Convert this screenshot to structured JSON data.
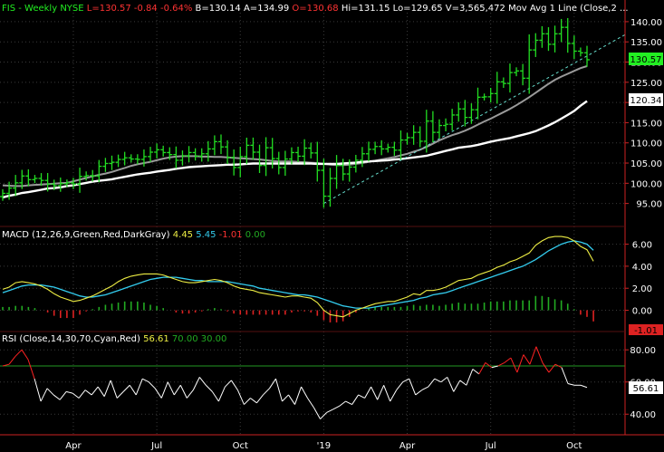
{
  "header": {
    "symbol": "FIS",
    "period": "Weekly",
    "exchange": "NYSE",
    "last": "L=130.57",
    "change": "-0.84",
    "change_pct": "-0.64%",
    "bid": "B=130.14",
    "ask": "A=134.99",
    "open": "O=130.68",
    "high": "Hi=131.15",
    "low": "Lo=129.65",
    "volume": "V=3,565,472",
    "ma_title": "Mov Avg 1 Line (Close,2 ..."
  },
  "macd_header": {
    "name": "MACD (12,26,9,Green,Red,DarkGray)",
    "v1": "4.45",
    "v2": "5.45",
    "v3": "-1.01",
    "v4": "0.00"
  },
  "rsi_header": {
    "name": "RSI (Close,14,30,70,Cyan,Red)",
    "v1": "56.61",
    "v2": "70.00",
    "v3": "30.00"
  },
  "x_labels": [
    "Apr",
    "Jul",
    "Oct",
    "'19",
    "Apr",
    "Jul",
    "Oct"
  ],
  "price_ticks": [
    "140.00",
    "135.00",
    "130.00",
    "125.00",
    "120.00",
    "115.00",
    "110.00",
    "105.00",
    "100.00",
    "95.00"
  ],
  "macd_ticks": [
    "6.00",
    "4.00",
    "2.00",
    "0.00"
  ],
  "rsi_ticks": [
    "80.00",
    "60.00",
    "40.00"
  ],
  "badges": {
    "last_price": "130.57",
    "ma_value": "120.34",
    "macd_hist": "-1.01",
    "rsi_value": "56.61"
  },
  "colors": {
    "bars": "#22dd22",
    "ma_white": "#ffffff",
    "ma_gray": "#9a9a9a",
    "trendline": "#66ddcc",
    "macd": "#eeee44",
    "signal": "#33ccee",
    "hist_pos": "#22aa22",
    "hist_neg": "#dd2222",
    "rsi": "#ffffff",
    "rsi_overbought": "#ff2222",
    "rsi_70": "#229922",
    "badge_last": "#22ee22"
  },
  "chart_data": [
    {
      "type": "ohlc",
      "title": "FIS - Weekly  NYSE",
      "period": "weekly",
      "x_axis_labels": [
        "Apr",
        "Jul",
        "Oct",
        "'19",
        "Apr",
        "Jul",
        "Oct"
      ],
      "ylim": [
        92,
        142
      ],
      "last": 130.57,
      "start_year": 2018,
      "end_year": 2019,
      "close": [
        97.5,
        98.8,
        100.1,
        101.8,
        100.9,
        101.2,
        100.7,
        99.8,
        99.4,
        99.9,
        100.1,
        99.8,
        101.7,
        101.9,
        101.8,
        104.2,
        104.9,
        105.2,
        105.9,
        106.3,
        106.0,
        105.9,
        106.6,
        107.7,
        108.3,
        107.6,
        107.1,
        105.7,
        106.8,
        107.6,
        106.7,
        107.3,
        108.5,
        110.3,
        109.0,
        106.4,
        103.9,
        106.6,
        109.4,
        107.7,
        104.4,
        108.8,
        106.1,
        103.9,
        106.0,
        107.6,
        106.7,
        108.7,
        107.5,
        103.2,
        96.8,
        101.2,
        104.4,
        102.3,
        104.0,
        105.7,
        107.3,
        108.4,
        109.1,
        108.5,
        108.9,
        108.2,
        110.7,
        111.3,
        112.6,
        110.4,
        115.4,
        112.6,
        114.3,
        114.6,
        116.9,
        118.4,
        116.3,
        118.2,
        121.3,
        121.4,
        122.2,
        125.1,
        124.7,
        127.4,
        127.8,
        126.0,
        133.0,
        135.4,
        137.0,
        134.4,
        137.0,
        138.6,
        134.6,
        132.7,
        132.3,
        130.57
      ],
      "ma_white": [
        96.5,
        96.9,
        97.2,
        97.6,
        97.8,
        98.1,
        98.4,
        98.7,
        98.8,
        99.0,
        99.3,
        99.5,
        99.8,
        100.1,
        100.4,
        100.6,
        100.8,
        101.0,
        101.3,
        101.6,
        101.9,
        102.2,
        102.4,
        102.6,
        102.9,
        103.1,
        103.3,
        103.6,
        103.8,
        104.0,
        104.1,
        104.2,
        104.3,
        104.4,
        104.5,
        104.6,
        104.6,
        104.7,
        104.8,
        104.9,
        104.9,
        104.9,
        104.9,
        104.9,
        104.9,
        104.9,
        104.9,
        104.9,
        104.9,
        104.8,
        104.8,
        104.8,
        104.8,
        104.9,
        105.0,
        105.1,
        105.3,
        105.4,
        105.5,
        105.6,
        105.7,
        105.9,
        106.0,
        106.2,
        106.4,
        106.6,
        106.8,
        107.2,
        107.6,
        108.0,
        108.4,
        108.8,
        109.0,
        109.2,
        109.5,
        109.9,
        110.3,
        110.6,
        110.9,
        111.2,
        111.6,
        112.0,
        112.4,
        112.9,
        113.6,
        114.3,
        115.1,
        116.0,
        116.9,
        117.9,
        119.2,
        120.34
      ],
      "ma_gray": [
        99.5,
        99.4,
        99.3,
        99.3,
        99.5,
        99.6,
        99.7,
        99.8,
        99.9,
        100.0,
        100.1,
        100.5,
        100.9,
        101.3,
        101.7,
        102.1,
        102.4,
        102.8,
        103.3,
        103.8,
        104.3,
        104.7,
        105.0,
        105.3,
        105.7,
        106.1,
        106.4,
        106.6,
        106.7,
        106.7,
        106.7,
        106.6,
        106.6,
        106.5,
        106.5,
        106.4,
        106.3,
        106.2,
        106.1,
        106.0,
        105.9,
        105.7,
        105.5,
        105.4,
        105.4,
        105.4,
        105.3,
        105.2,
        105.1,
        105.0,
        104.8,
        104.6,
        104.5,
        104.5,
        104.6,
        104.8,
        105.0,
        105.3,
        105.6,
        105.9,
        106.2,
        106.5,
        106.9,
        107.3,
        107.8,
        108.3,
        109.0,
        109.8,
        110.6,
        111.3,
        111.9,
        112.4,
        113.0,
        113.7,
        114.5,
        115.3,
        116.0,
        116.8,
        117.6,
        118.4,
        119.3,
        120.3,
        121.3,
        122.4,
        123.5,
        124.6,
        125.6,
        126.4,
        127.1,
        127.8,
        128.5,
        129.0
      ],
      "trendline": {
        "from_week": 50,
        "from_value": 95.0,
        "to_week": 91,
        "to_value": 131.5
      }
    },
    {
      "type": "macd",
      "title": "MACD (12,26,9,Green,Red,DarkGray)",
      "ylim": [
        -1.6,
        7.2
      ],
      "macd": [
        1.9,
        2.1,
        2.5,
        2.6,
        2.5,
        2.4,
        2.2,
        1.9,
        1.5,
        1.2,
        1.0,
        0.8,
        0.9,
        1.1,
        1.3,
        1.6,
        1.9,
        2.2,
        2.6,
        2.9,
        3.1,
        3.2,
        3.3,
        3.3,
        3.3,
        3.2,
        3.0,
        2.8,
        2.6,
        2.5,
        2.5,
        2.6,
        2.7,
        2.8,
        2.7,
        2.5,
        2.2,
        2.0,
        1.9,
        1.8,
        1.6,
        1.5,
        1.4,
        1.3,
        1.2,
        1.3,
        1.3,
        1.2,
        1.1,
        0.7,
        0.0,
        -0.4,
        -0.5,
        -0.6,
        -0.3,
        0.0,
        0.2,
        0.4,
        0.6,
        0.7,
        0.8,
        0.8,
        1.0,
        1.2,
        1.5,
        1.4,
        1.8,
        1.8,
        1.9,
        2.1,
        2.4,
        2.7,
        2.8,
        2.9,
        3.2,
        3.4,
        3.6,
        3.9,
        4.1,
        4.4,
        4.6,
        4.9,
        5.2,
        5.9,
        6.3,
        6.6,
        6.7,
        6.7,
        6.6,
        6.3,
        5.8,
        5.5,
        4.45
      ],
      "signal": [
        1.6,
        1.8,
        2.0,
        2.2,
        2.3,
        2.3,
        2.3,
        2.2,
        2.1,
        1.9,
        1.7,
        1.5,
        1.3,
        1.2,
        1.2,
        1.3,
        1.4,
        1.6,
        1.8,
        2.0,
        2.2,
        2.4,
        2.6,
        2.8,
        2.9,
        3.0,
        3.0,
        3.0,
        2.9,
        2.8,
        2.7,
        2.7,
        2.6,
        2.6,
        2.6,
        2.6,
        2.5,
        2.4,
        2.3,
        2.2,
        2.0,
        1.9,
        1.8,
        1.7,
        1.6,
        1.5,
        1.4,
        1.4,
        1.3,
        1.2,
        1.0,
        0.8,
        0.6,
        0.4,
        0.3,
        0.2,
        0.2,
        0.2,
        0.3,
        0.4,
        0.5,
        0.6,
        0.7,
        0.8,
        0.9,
        1.1,
        1.2,
        1.4,
        1.5,
        1.6,
        1.8,
        2.0,
        2.2,
        2.4,
        2.6,
        2.8,
        3.0,
        3.2,
        3.4,
        3.6,
        3.8,
        4.0,
        4.3,
        4.6,
        5.0,
        5.4,
        5.7,
        6.0,
        6.2,
        6.3,
        6.2,
        6.0,
        5.45
      ],
      "histogram": [
        0.3,
        0.3,
        0.4,
        0.4,
        0.3,
        0.2,
        0.0,
        -0.2,
        -0.5,
        -0.7,
        -0.7,
        -0.7,
        -0.4,
        -0.1,
        0.1,
        0.3,
        0.5,
        0.6,
        0.7,
        0.8,
        0.8,
        0.8,
        0.7,
        0.5,
        0.4,
        0.2,
        0.0,
        -0.2,
        -0.3,
        -0.3,
        -0.2,
        -0.1,
        0.1,
        0.2,
        0.1,
        -0.1,
        -0.3,
        -0.4,
        -0.4,
        -0.4,
        -0.4,
        -0.4,
        -0.4,
        -0.4,
        -0.4,
        -0.2,
        -0.1,
        -0.1,
        -0.2,
        -0.5,
        -0.9,
        -1.1,
        -1.1,
        -1.0,
        -0.6,
        -0.2,
        0.0,
        0.2,
        0.3,
        0.3,
        0.3,
        0.3,
        0.3,
        0.4,
        0.5,
        0.4,
        0.5,
        0.5,
        0.4,
        0.5,
        0.6,
        0.7,
        0.6,
        0.6,
        0.6,
        0.7,
        0.8,
        0.8,
        0.8,
        0.9,
        0.9,
        0.9,
        0.9,
        1.3,
        1.3,
        1.2,
        1.0,
        0.9,
        0.6,
        0.1,
        -0.4,
        -0.6,
        -1.01
      ]
    },
    {
      "type": "rsi",
      "title": "RSI (Close,14,30,70,Cyan,Red)",
      "ylim": [
        30,
        88
      ],
      "overbought": 70,
      "oversold": 30,
      "values": [
        70,
        71,
        76,
        80,
        74,
        62,
        48,
        56,
        52,
        49,
        54,
        53,
        50,
        55,
        52,
        57,
        51,
        61,
        50,
        54,
        58,
        52,
        62,
        60,
        56,
        50,
        60,
        52,
        58,
        50,
        55,
        63,
        58,
        54,
        48,
        57,
        61,
        55,
        46,
        50,
        47,
        52,
        56,
        62,
        48,
        52,
        46,
        57,
        50,
        44,
        37,
        41,
        43,
        45,
        48,
        46,
        52,
        50,
        57,
        49,
        58,
        48,
        55,
        60,
        62,
        52,
        55,
        57,
        62,
        60,
        63,
        54,
        61,
        58,
        68,
        65,
        72,
        69,
        70,
        72,
        75,
        66,
        77,
        71,
        82,
        72,
        66,
        71,
        69,
        59,
        58,
        58,
        56.61
      ]
    }
  ]
}
